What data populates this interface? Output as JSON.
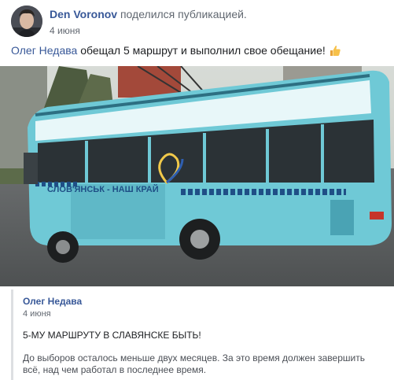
{
  "post": {
    "author": "Den Voronov",
    "action": "поделился публикацией.",
    "date": "4 июня",
    "mention": "Олег Недава",
    "text": "обещал 5 маршрут и выполнил свое обещание!",
    "emoji_icon": "thumbs-up-icon"
  },
  "photo": {
    "bus_sign": "СЛОВ'ЯНСЬК - НАШ КРАЙ",
    "bus_color": "#6fc9d6"
  },
  "shared_post": {
    "author": "Олег Недава",
    "date": "4 июня",
    "headline": "5-МУ МАРШРУТУ В СЛАВЯНСКЕ БЫТЬ!",
    "body": "До выборов осталось меньше двух месяцев. За это время должен завершить всё, над чем работал в последнее время."
  },
  "colors": {
    "link": "#385898",
    "secondary": "#616770",
    "divider": "#dddfe2"
  }
}
